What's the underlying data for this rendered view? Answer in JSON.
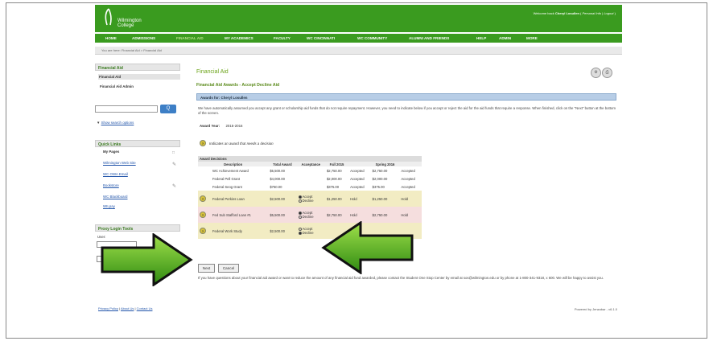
{
  "brand": {
    "name_line1": "Wilmington",
    "name_line2": "College",
    "primary": "#3a9b1f",
    "accent": "#6ca41a"
  },
  "welcome": {
    "prefix": "Welcome back",
    "user": "Cheryl Losullen",
    "personal_info": "Personal Info",
    "logout": "Logout"
  },
  "nav": [
    "HOME",
    "ADMISSIONS",
    "FINANCIAL AID",
    "MY ACADEMICS",
    "FACULTY",
    "WC CINCINNATI",
    "WC COMMUNITY",
    "ALUMNI AND FRIENDS",
    "HELP",
    "ADMIN",
    "MORE"
  ],
  "nav_active": "FINANCIAL AID",
  "breadcrumb": "You are here: Financial Aid > Financial Aid",
  "sidebar": {
    "financial_aid_title": "Financial Aid",
    "fa_items": [
      "Financial Aid",
      "Financial Aid Admin"
    ],
    "search_placeholder": "",
    "search_button": "Q",
    "show_search_options": "Show search options",
    "quick_links_title": "Quick Links",
    "quick_links": [
      "My Pages",
      "Wilmington Web Site",
      "WC OWA Email",
      "Bookstore",
      "WC Blackboard",
      "WILpay"
    ],
    "proxy_title": "Proxy Login Tools",
    "user_label": "User:"
  },
  "main": {
    "title": "Financial Aid",
    "subtitle": "Financial Aid Awards - Accept Decline Aid",
    "bar_label": "Awards for: Cheryl Losullen",
    "paragraph": "We have automatically assumed you accept any grant or scholarship aid funds that do not require repayment. However, you need to indicate below if you accept or reject the aid for the aid funds that require a response. When finished, click on the \"Next\" button at the bottom of the screen.",
    "award_year_label": "Award Year:",
    "award_year_value": "2015-2016",
    "note": "Indicates an award that needs a decision",
    "hold_icon": "?"
  },
  "awards": {
    "title": "Award Decisions",
    "headers": [
      "Description",
      "Total Award",
      "Acceptance",
      "Fall 2015",
      "",
      "Spring 2016",
      ""
    ],
    "rows": [
      {
        "desc": "WC Achievement Award",
        "total": "$5,500.00",
        "fall": "$2,750.00",
        "fall_status": "Accepted",
        "spring": "$2,750.00",
        "spring_status": "Accepted"
      },
      {
        "desc": "Federal Pell Grant",
        "total": "$4,000.00",
        "fall": "$2,000.00",
        "fall_status": "Accepted",
        "spring": "$2,000.00",
        "spring_status": "Accepted"
      },
      {
        "desc": "Federal Seog Grant",
        "total": "$750.00",
        "fall": "$375.00",
        "fall_status": "Accepted",
        "spring": "$375.00",
        "spring_status": "Accepted"
      },
      {
        "desc": "Federal Perkins Loan",
        "total": "$2,500.00",
        "accept": "Accept",
        "decline": "Decline",
        "fall": "$1,250.00",
        "fall_status": "Hold",
        "spring": "$1,250.00",
        "spring_status": "Hold"
      },
      {
        "desc": "Fed Sub Stafford Loan #1",
        "total": "$5,500.00",
        "accept": "Accept",
        "decline": "Decline",
        "fall": "$2,750.00",
        "fall_status": "Hold",
        "spring": "$2,750.00",
        "spring_status": "Hold"
      },
      {
        "desc": "Federal Work Study",
        "total": "$2,500.00",
        "accept": "Accept",
        "decline": "Decline",
        "fall": "",
        "fall_status": "",
        "spring": "",
        "spring_status": ""
      }
    ]
  },
  "buttons": {
    "next": "Next",
    "cancel": "Cancel"
  },
  "footer": {
    "paragraph": "If you have questions about your financial aid award or want to reduce the amount of any financial aid fund awarded, please contact the Student One Stop Center by email at sos@wilmington.edu or by phone at 1-800-341-9318, x 600. We will be happy to assist you.",
    "links": [
      "Privacy Policy",
      "About Us",
      "Contact Us"
    ],
    "powered": "Powered by Jenzabar - v6.1.0"
  }
}
